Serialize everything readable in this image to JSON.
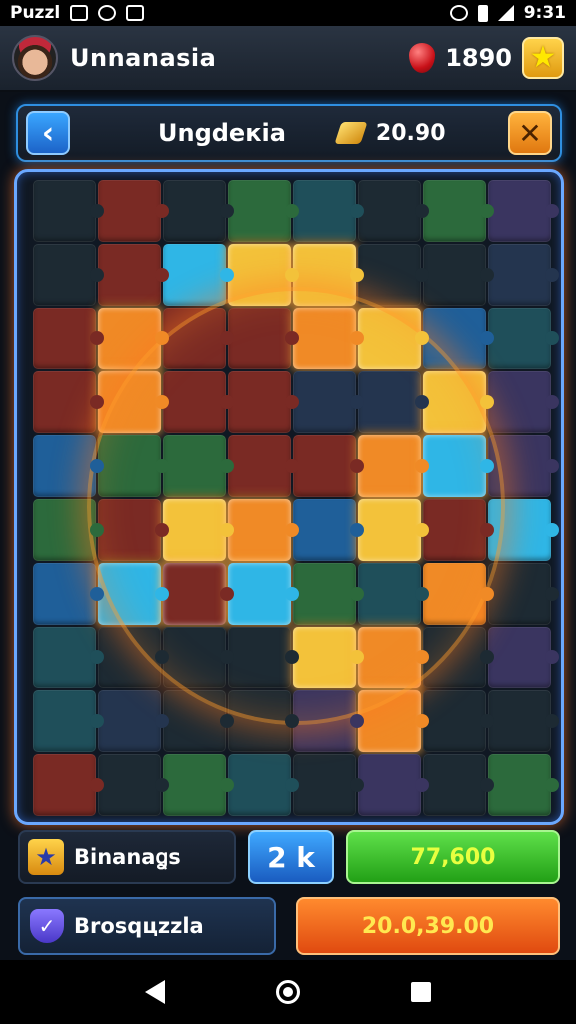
{
  "status_bar": {
    "app_name": "Puzzl",
    "time": "9:31"
  },
  "top_bar": {
    "player_name": "Unnanasia",
    "gems": "1890"
  },
  "header": {
    "back_glyph": "‹",
    "title": "Ungdeкia",
    "coins": "20.90",
    "close_glyph": "✕"
  },
  "board": {
    "rows": 10,
    "cols": 8,
    "colors": {
      "dark": "#1d2a33",
      "teal": "#1f4f5a",
      "green": "#2c6a3c",
      "blue": "#1f5f99",
      "cyan": "#2fb6e6",
      "yellow": "#f3c23a",
      "orange": "#f08a26",
      "red": "#7a2a24",
      "purple": "#3a3560",
      "navy": "#24354f"
    },
    "grid": [
      [
        "dark",
        "red",
        "dark",
        "green",
        "teal",
        "dark",
        "green",
        "purple"
      ],
      [
        "dark",
        "red",
        "cyan",
        "yellow",
        "yellow",
        "dark",
        "dark",
        "navy"
      ],
      [
        "red",
        "orange",
        "red",
        "red",
        "orange",
        "yellow",
        "blue",
        "teal"
      ],
      [
        "red",
        "orange",
        "red",
        "red",
        "navy",
        "navy",
        "yellow",
        "purple"
      ],
      [
        "blue",
        "green",
        "green",
        "red",
        "red",
        "orange",
        "cyan",
        "purple"
      ],
      [
        "green",
        "red",
        "yellow",
        "orange",
        "blue",
        "yellow",
        "red",
        "cyan"
      ],
      [
        "blue",
        "cyan",
        "red",
        "cyan",
        "green",
        "teal",
        "orange",
        "dark"
      ],
      [
        "teal",
        "dark",
        "dark",
        "dark",
        "yellow",
        "orange",
        "dark",
        "purple"
      ],
      [
        "teal",
        "navy",
        "dark",
        "dark",
        "purple",
        "orange",
        "dark",
        "dark"
      ],
      [
        "red",
        "dark",
        "green",
        "teal",
        "dark",
        "purple",
        "dark",
        "green"
      ]
    ],
    "lit": [
      [
        1,
        3
      ],
      [
        1,
        4
      ],
      [
        2,
        1
      ],
      [
        2,
        4
      ],
      [
        2,
        5
      ],
      [
        3,
        1
      ],
      [
        3,
        6
      ],
      [
        4,
        5
      ],
      [
        4,
        6
      ],
      [
        5,
        2
      ],
      [
        5,
        3
      ],
      [
        5,
        5
      ],
      [
        6,
        1
      ],
      [
        6,
        2
      ],
      [
        6,
        3
      ],
      [
        7,
        4
      ],
      [
        7,
        5
      ],
      [
        8,
        5
      ]
    ]
  },
  "bottom": {
    "info_label": "Binanaꬶs",
    "multiplier": "2 k",
    "green_value": "77,600",
    "puzzle_label": "Brosqцzzla",
    "orange_value": "20.0,39.00"
  },
  "icons": {
    "avatar": "player-avatar",
    "gem": "ruby-gem-icon",
    "star": "star-icon",
    "coin": "gold-coin-icon",
    "badge": "puzzle-star-badge-icon",
    "shield": "check-shield-icon"
  }
}
